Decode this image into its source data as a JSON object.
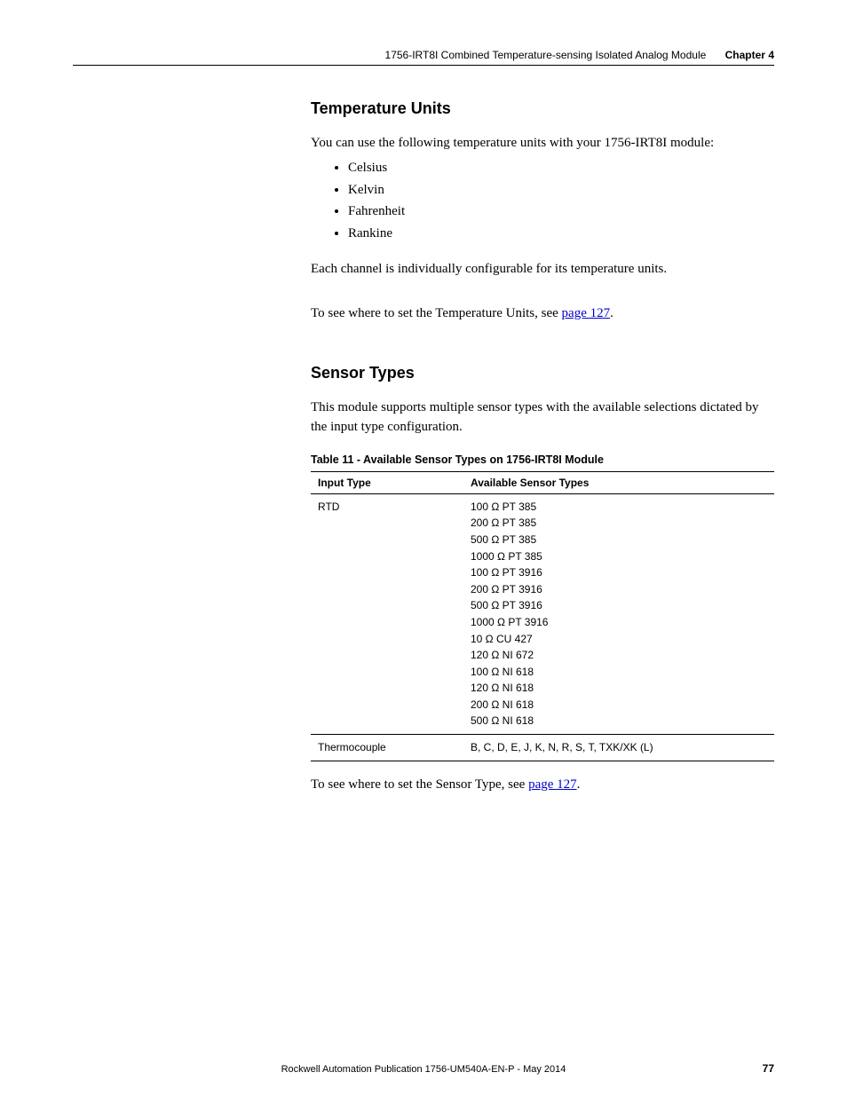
{
  "header": {
    "breadcrumb": "1756-IRT8I Combined Temperature-sensing Isolated Analog Module",
    "chapter": "Chapter 4"
  },
  "section1": {
    "heading": "Temperature Units",
    "intro": "You can use the following temperature units with your 1756-IRT8I module:",
    "bullets": [
      "Celsius",
      "Kelvin",
      "Fahrenheit",
      "Rankine"
    ],
    "para2": "Each channel is individually configurable for its temperature units.",
    "para3_pre": "To see where to set the Temperature Units, see ",
    "para3_link": "page 127",
    "para3_post": "."
  },
  "section2": {
    "heading": "Sensor Types",
    "intro": "This module supports multiple sensor types with the available selections dictated by the input type configuration.",
    "table_title": "Table 11 - Available Sensor Types on 1756-IRT8I Module",
    "table": {
      "headers": [
        "Input Type",
        "Available Sensor Types"
      ],
      "rows": [
        {
          "input_type": "RTD",
          "sensors": [
            "100 Ω PT 385",
            "200 Ω PT 385",
            "500 Ω PT 385",
            "1000 Ω PT 385",
            "100 Ω PT 3916",
            "200 Ω PT 3916",
            "500 Ω PT 3916",
            "1000 Ω PT 3916",
            "10 Ω CU 427",
            "120 Ω NI 672",
            "100 Ω NI 618",
            "120 Ω NI 618",
            "200 Ω NI 618",
            "500 Ω NI 618"
          ]
        },
        {
          "input_type": "Thermocouple",
          "sensors": [
            "B, C, D, E, J, K, N, R, S, T, TXK/XK (L)"
          ]
        }
      ]
    },
    "para2_pre": "To see where to set the Sensor Type, see ",
    "para2_link": "page 127",
    "para2_post": "."
  },
  "footer": {
    "pub": "Rockwell Automation Publication 1756-UM540A-EN-P - May 2014",
    "page": "77"
  }
}
